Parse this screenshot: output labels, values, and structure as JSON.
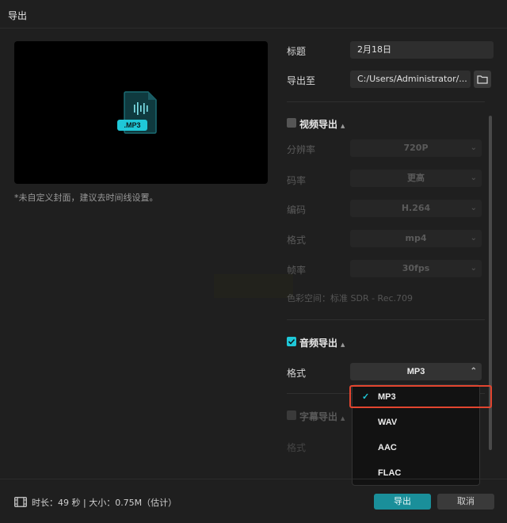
{
  "window": {
    "title": "导出"
  },
  "preview": {
    "file_tag": ".MP3",
    "note": "*未自定义封面，建议去时间线设置。"
  },
  "fields": {
    "title_label": "标题",
    "title_value": "2月18日",
    "export_to_label": "导出至",
    "export_to_value": "C:/Users/Administrator/..."
  },
  "video_export": {
    "heading": "视频导出",
    "enabled": false,
    "resolution_label": "分辨率",
    "resolution_value": "720P",
    "bitrate_label": "码率",
    "bitrate_value": "更高",
    "codec_label": "编码",
    "codec_value": "H.264",
    "format_label": "格式",
    "format_value": "mp4",
    "fps_label": "帧率",
    "fps_value": "30fps",
    "colorspace": "色彩空间：标准 SDR - Rec.709"
  },
  "audio_export": {
    "heading": "音频导出",
    "enabled": true,
    "format_label": "格式",
    "format_value": "MP3",
    "options": [
      "MP3",
      "WAV",
      "AAC",
      "FLAC"
    ],
    "selected": "MP3"
  },
  "subtitle_export": {
    "heading": "字幕导出",
    "enabled": false,
    "format_label": "格式"
  },
  "footer": {
    "info": "时长：49 秒 | 大小：0.75M（估计）",
    "export_label": "导出",
    "cancel_label": "取消"
  },
  "colors": {
    "accent": "#1fc8d8",
    "primary_button": "#1a8f9a",
    "highlight_border": "#e2452f"
  }
}
